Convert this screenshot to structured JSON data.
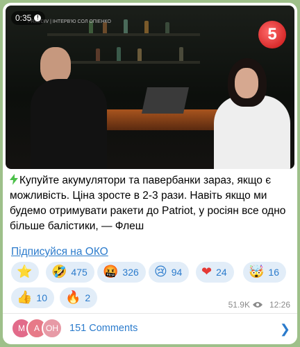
{
  "video": {
    "time": "0:35",
    "channel_overlay": "PRAVDIV | ІНТЕРВ'Ю СОЛ ОПІЕНКО",
    "logo_text": "5"
  },
  "post": {
    "text": "Купуйте акумулятори та павербанки зараз, якщо є можливість. Ціна зросте в 2-3 рази. Навіть якщо ми будемо отримувати ракети до Patriot, у росіян все одно більше балістики, — Флеш",
    "link_label": "Підписуйся на ОКО"
  },
  "reactions": [
    {
      "emoji": "⭐",
      "count": "",
      "icon": "star-icon"
    },
    {
      "emoji": "🤣",
      "count": "475",
      "icon": "laughing-face-icon"
    },
    {
      "emoji": "🤬",
      "count": "326",
      "icon": "angry-face-icon"
    },
    {
      "emoji": "😢",
      "count": "94",
      "icon": "crying-face-icon"
    },
    {
      "emoji": "❤",
      "count": "24",
      "icon": "heart-icon"
    },
    {
      "emoji": "🤯",
      "count": "16",
      "icon": "exploding-head-icon"
    },
    {
      "emoji": "👍",
      "count": "10",
      "icon": "thumbs-up-icon"
    },
    {
      "emoji": "🔥",
      "count": "2",
      "icon": "fire-icon"
    }
  ],
  "meta": {
    "views": "51.9K",
    "time": "12:26"
  },
  "comments": {
    "label": "151 Comments",
    "avatars": [
      {
        "letter": "M",
        "color": "#e26b8a"
      },
      {
        "letter": "A",
        "color": "#e77a88"
      },
      {
        "letter": "OH",
        "color": "#e79aa6"
      }
    ]
  },
  "colors": {
    "accent": "#2b7bcc",
    "reaction_bg": "#e2edf8",
    "chat_bg": "#9ec08a"
  }
}
